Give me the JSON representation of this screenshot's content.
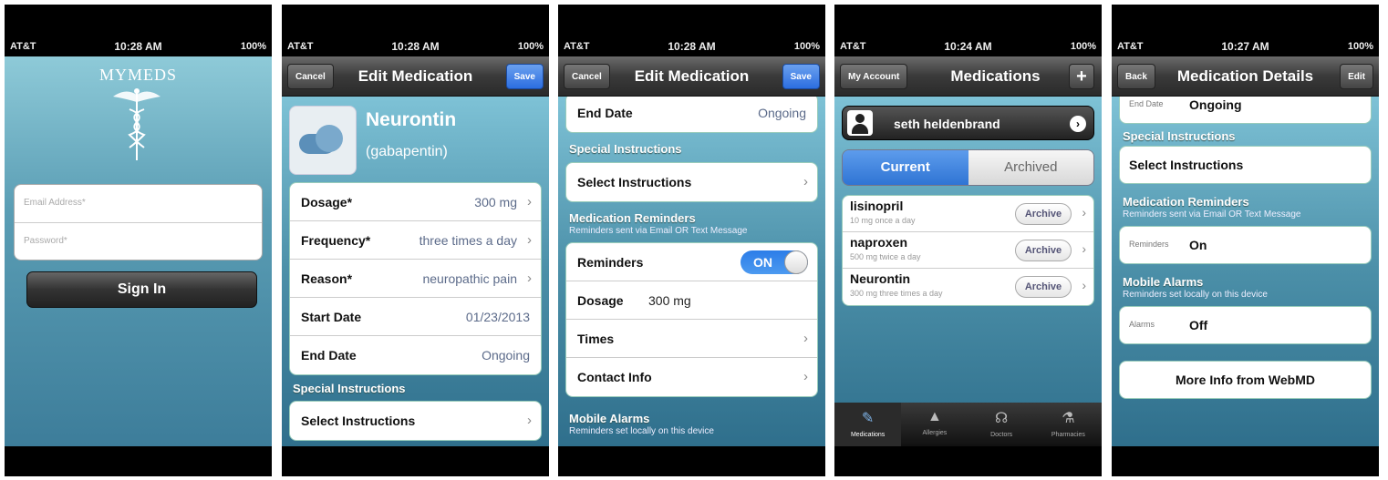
{
  "status": {
    "carrier": "AT&T",
    "battery": "100%",
    "times": [
      "10:28 AM",
      "10:28 AM",
      "10:28 AM",
      "10:24 AM",
      "10:27 AM"
    ]
  },
  "screen1": {
    "logo": "MYMEDS",
    "email_placeholder": "Email Address*",
    "password_placeholder": "Password*",
    "sign_in": "Sign In"
  },
  "screen2": {
    "cancel": "Cancel",
    "title": "Edit Medication",
    "save": "Save",
    "med_name": "Neurontin",
    "med_generic": "(gabapentin)",
    "rows": [
      {
        "label": "Dosage*",
        "value": "300 mg"
      },
      {
        "label": "Frequency*",
        "value": "three times a day"
      },
      {
        "label": "Reason*",
        "value": "neuropathic pain"
      }
    ],
    "start_label": "Start Date",
    "start_value": "01/23/2013",
    "end_label": "End Date",
    "end_value": "Ongoing",
    "special_header": "Special Instructions",
    "select_instructions": "Select Instructions"
  },
  "screen3": {
    "cancel": "Cancel",
    "title": "Edit Medication",
    "save": "Save",
    "end_label": "End Date",
    "end_value": "Ongoing",
    "special_header": "Special Instructions",
    "select_instructions": "Select Instructions",
    "reminders_header": "Medication Reminders",
    "reminders_sub": "Reminders sent via Email OR Text Message",
    "reminders_label": "Reminders",
    "reminders_switch": "ON",
    "dosage_label": "Dosage",
    "dosage_value": "300 mg",
    "times_label": "Times",
    "contact_label": "Contact Info",
    "alarms_header": "Mobile Alarms",
    "alarms_sub": "Reminders set locally on this device"
  },
  "screen4": {
    "account": "My Account",
    "title": "Medications",
    "add": "+",
    "user": "seth heldenbrand",
    "seg_current": "Current",
    "seg_archived": "Archived",
    "archive_label": "Archive",
    "meds": [
      {
        "name": "lisinopril",
        "detail": "10 mg once a day"
      },
      {
        "name": "naproxen",
        "detail": "500 mg twice a day"
      },
      {
        "name": "Neurontin",
        "detail": "300 mg three times a day"
      }
    ],
    "tabs": [
      "Medications",
      "Allergies",
      "Doctors",
      "Pharmacies"
    ]
  },
  "screen5": {
    "back": "Back",
    "title": "Medication Details",
    "edit": "Edit",
    "end_label": "End Date",
    "end_value": "Ongoing",
    "special_header": "Special Instructions",
    "select_instructions": "Select Instructions",
    "reminders_header": "Medication Reminders",
    "reminders_sub": "Reminders sent via Email OR Text Message",
    "reminders_key": "Reminders",
    "reminders_value": "On",
    "alarms_header": "Mobile Alarms",
    "alarms_sub": "Reminders set locally on this device",
    "alarms_key": "Alarms",
    "alarms_value": "Off",
    "more_info": "More Info from WebMD"
  }
}
